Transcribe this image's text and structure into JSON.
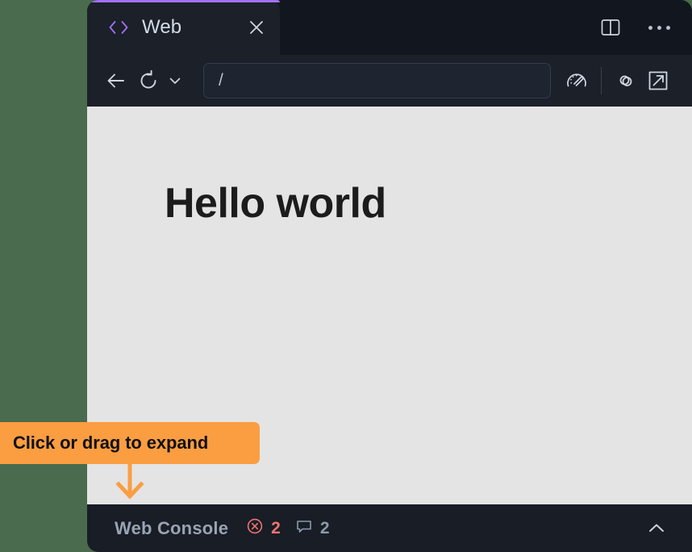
{
  "desktop": {
    "background_color": "#4a6b4d"
  },
  "window": {
    "background_color": "#1b2029",
    "accent_color": "#a371f7"
  },
  "tab_strip": {
    "tabs": [
      {
        "icon": "code-brackets-icon",
        "label": "Web",
        "active": true,
        "close_icon": "close-icon"
      }
    ],
    "actions": [
      {
        "icon": "split-pane-icon",
        "label": "Split pane"
      },
      {
        "icon": "more-options-icon",
        "label": "More options"
      }
    ]
  },
  "toolbar": {
    "back_icon": "back-arrow-icon",
    "reload_icon": "reload-icon",
    "reload_menu_icon": "chevron-down-icon",
    "url": {
      "value": "/",
      "placeholder": "/"
    },
    "performance_icon": "speedometer-icon",
    "link_icon": "link-icon",
    "open_external_icon": "open-external-icon"
  },
  "page": {
    "background_color": "#e4e4e4",
    "heading": "Hello world"
  },
  "console": {
    "title": "Web Console",
    "error_icon": "error-circle-icon",
    "error_count": "2",
    "error_color": "#f07470",
    "message_icon": "message-bubble-icon",
    "message_count": "2",
    "message_color": "#8e99aa",
    "toggle_icon": "chevron-up-icon"
  },
  "callout": {
    "text": "Click or drag to expand",
    "background_color": "#fb9d41",
    "arrow_icon": "arrow-down-icon"
  }
}
